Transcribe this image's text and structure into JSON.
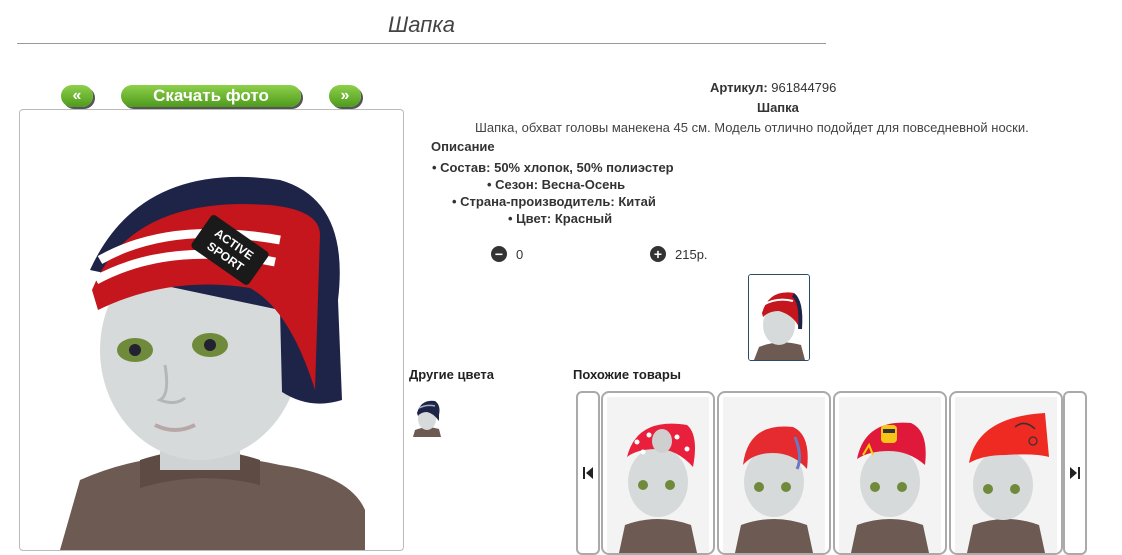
{
  "page": {
    "title": "Шапка"
  },
  "nav": {
    "prev_label": "«",
    "download_label": "Скачать фото",
    "next_label": "»"
  },
  "product": {
    "sku_label": "Артикул:",
    "sku_value": "961844796",
    "name": "Шапка",
    "description": "Шапка, обхват головы манекена 45 см. Модель отлично подойдет для повседневной носки.",
    "description_heading": "Описание",
    "attributes": [
      "Состав: 50% хлопок, 50% полиэстер",
      "Сезон: Весна-Осень",
      "Страна-производитель: Китай",
      "Цвет: Красный"
    ],
    "quantity": "0",
    "price": "215р."
  },
  "sections": {
    "other_colors": "Другие цвета",
    "similar": "Похожие товары"
  },
  "similar_items": [
    {
      "hat_color": "#e8203c",
      "pattern": "dots"
    },
    {
      "hat_color": "#e52a30",
      "pattern": "plain"
    },
    {
      "hat_color": "#e0193a",
      "pattern": "print"
    },
    {
      "hat_color": "#ee2a22",
      "pattern": "script"
    }
  ],
  "colors": {
    "accent_green": "#5aa829",
    "hat_red": "#c4161c",
    "hat_navy": "#1d2447",
    "sweater": "#6d5a52"
  }
}
